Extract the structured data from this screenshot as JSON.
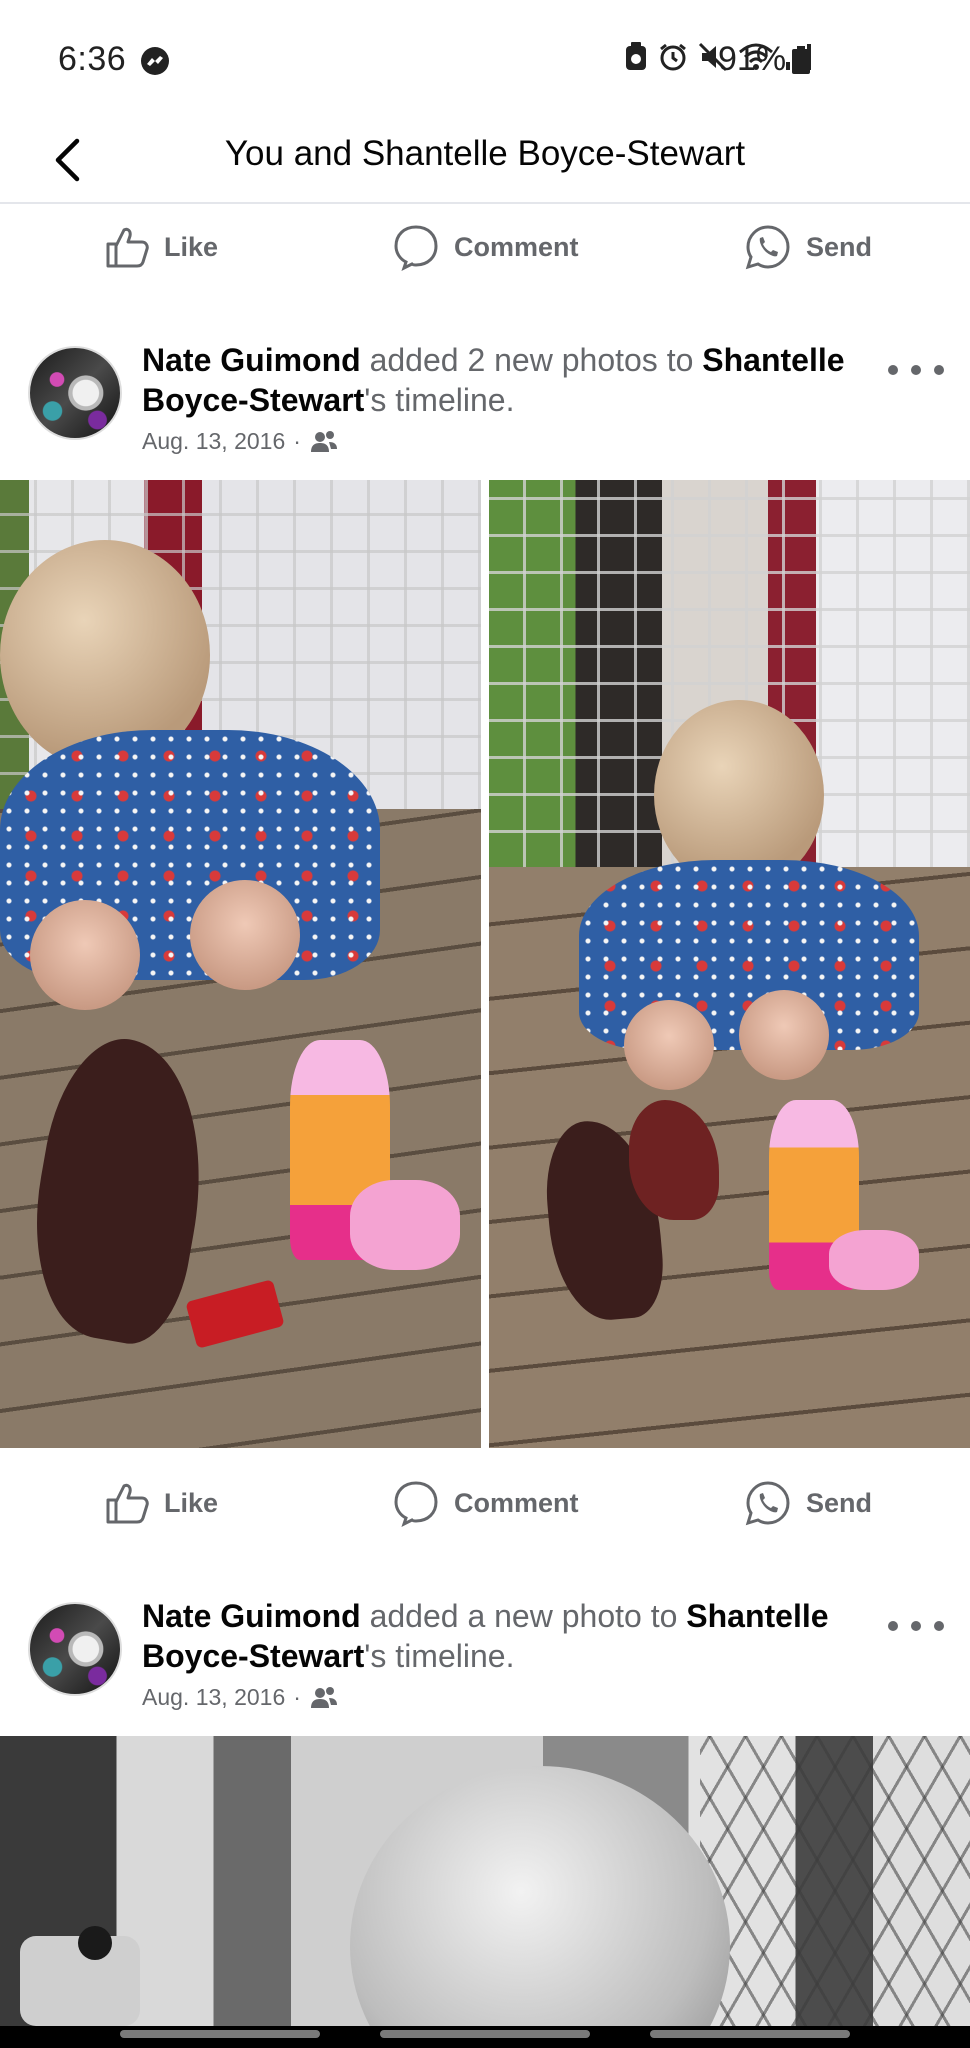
{
  "status_bar": {
    "time": "6:36",
    "battery": "91%"
  },
  "header": {
    "title": "You and Shantelle Boyce-Stewart"
  },
  "actions": {
    "like": "Like",
    "comment": "Comment",
    "send": "Send"
  },
  "posts": [
    {
      "author": "Nate Guimond",
      "verb": " added 2 new photos to ",
      "target": "Shantelle Boyce-Stewart",
      "suffix": "'s timeline.",
      "date": "Aug. 13, 2016",
      "separator": " · "
    },
    {
      "author": "Nate Guimond",
      "verb": " added a new photo to ",
      "target": "Shantelle Boyce-Stewart",
      "suffix": "'s timeline.",
      "date": "Aug. 13, 2016",
      "separator": " · "
    }
  ],
  "colors": {
    "text_primary": "#050505",
    "text_secondary": "#65676b",
    "divider": "#e4e6eb"
  },
  "icons": {
    "back": "chevron-left-icon",
    "messenger": "messenger-icon",
    "like": "thumbs-up-icon",
    "comment": "comment-bubble-icon",
    "send": "whatsapp-send-icon",
    "audience": "friends-icon",
    "more": "more-dots-icon"
  }
}
